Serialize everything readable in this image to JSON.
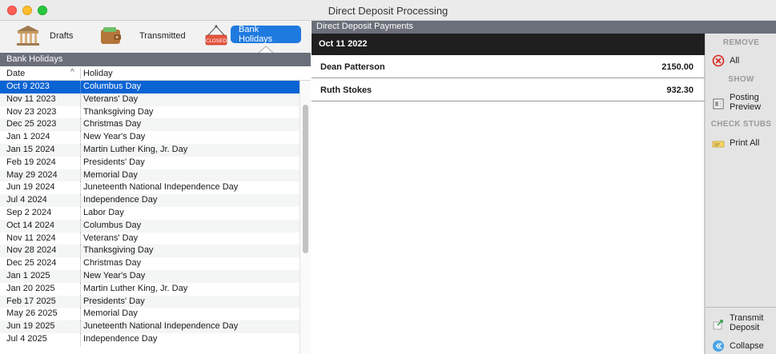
{
  "window": {
    "title": "Direct Deposit Processing"
  },
  "tabs": {
    "drafts": "Drafts",
    "transmitted": "Transmitted",
    "closed_sign": "CLOSED",
    "bank_holidays": "Bank Holidays"
  },
  "holidays": {
    "section_title": "Bank Holidays",
    "col_date": "Date",
    "col_holiday": "Holiday",
    "sort_indicator": "^",
    "rows": [
      {
        "date": "Oct 9 2023",
        "name": "Columbus Day"
      },
      {
        "date": "Nov 11 2023",
        "name": "Veterans' Day"
      },
      {
        "date": "Nov 23 2023",
        "name": "Thanksgiving Day"
      },
      {
        "date": "Dec 25 2023",
        "name": "Christmas Day"
      },
      {
        "date": "Jan 1 2024",
        "name": "New Year's Day"
      },
      {
        "date": "Jan 15 2024",
        "name": "Martin Luther King, Jr. Day"
      },
      {
        "date": "Feb 19 2024",
        "name": "Presidents' Day"
      },
      {
        "date": "May 29 2024",
        "name": "Memorial Day"
      },
      {
        "date": "Jun 19 2024",
        "name": "Juneteenth National Independence Day"
      },
      {
        "date": "Jul 4 2024",
        "name": "Independence Day"
      },
      {
        "date": "Sep 2 2024",
        "name": "Labor Day"
      },
      {
        "date": "Oct 14 2024",
        "name": "Columbus Day"
      },
      {
        "date": "Nov 11 2024",
        "name": "Veterans' Day"
      },
      {
        "date": "Nov 28 2024",
        "name": "Thanksgiving Day"
      },
      {
        "date": "Dec 25 2024",
        "name": "Christmas Day"
      },
      {
        "date": "Jan 1 2025",
        "name": "New Year's Day"
      },
      {
        "date": "Jan 20 2025",
        "name": "Martin Luther King, Jr. Day"
      },
      {
        "date": "Feb 17 2025",
        "name": "Presidents' Day"
      },
      {
        "date": "May 26 2025",
        "name": "Memorial Day"
      },
      {
        "date": "Jun 19 2025",
        "name": "Juneteenth National Independence Day"
      },
      {
        "date": "Jul 4 2025",
        "name": "Independence Day"
      }
    ],
    "selected_index": 0
  },
  "payments": {
    "section_title": "Direct Deposit Payments",
    "date": "Oct 11 2022",
    "items": [
      {
        "name": "Dean Patterson",
        "amount": "2150.00"
      },
      {
        "name": "Ruth Stokes",
        "amount": "932.30"
      }
    ]
  },
  "sidebar": {
    "remove_title": "REMOVE",
    "remove_all": "All",
    "show_title": "SHOW",
    "posting_preview_1": "Posting",
    "posting_preview_2": "Preview",
    "check_stubs_title": "CHECK STUBS",
    "print_all": "Print All",
    "transmit_1": "Transmit",
    "transmit_2": "Deposit",
    "collapse": "Collapse"
  },
  "colors": {
    "accent": "#1f7ae0",
    "selection": "#0a63d3",
    "section_header": "#6b6f7a",
    "date_bar": "#1f1f1f"
  },
  "icons": {
    "drafts": "bank-building-icon",
    "transmitted": "wallet-icon",
    "closed": "closed-sign-icon",
    "remove": "remove-circle-icon",
    "posting_preview": "document-preview-icon",
    "print_all": "check-stub-icon",
    "transmit": "transmit-arrow-icon",
    "collapse": "collapse-chevron-icon"
  }
}
